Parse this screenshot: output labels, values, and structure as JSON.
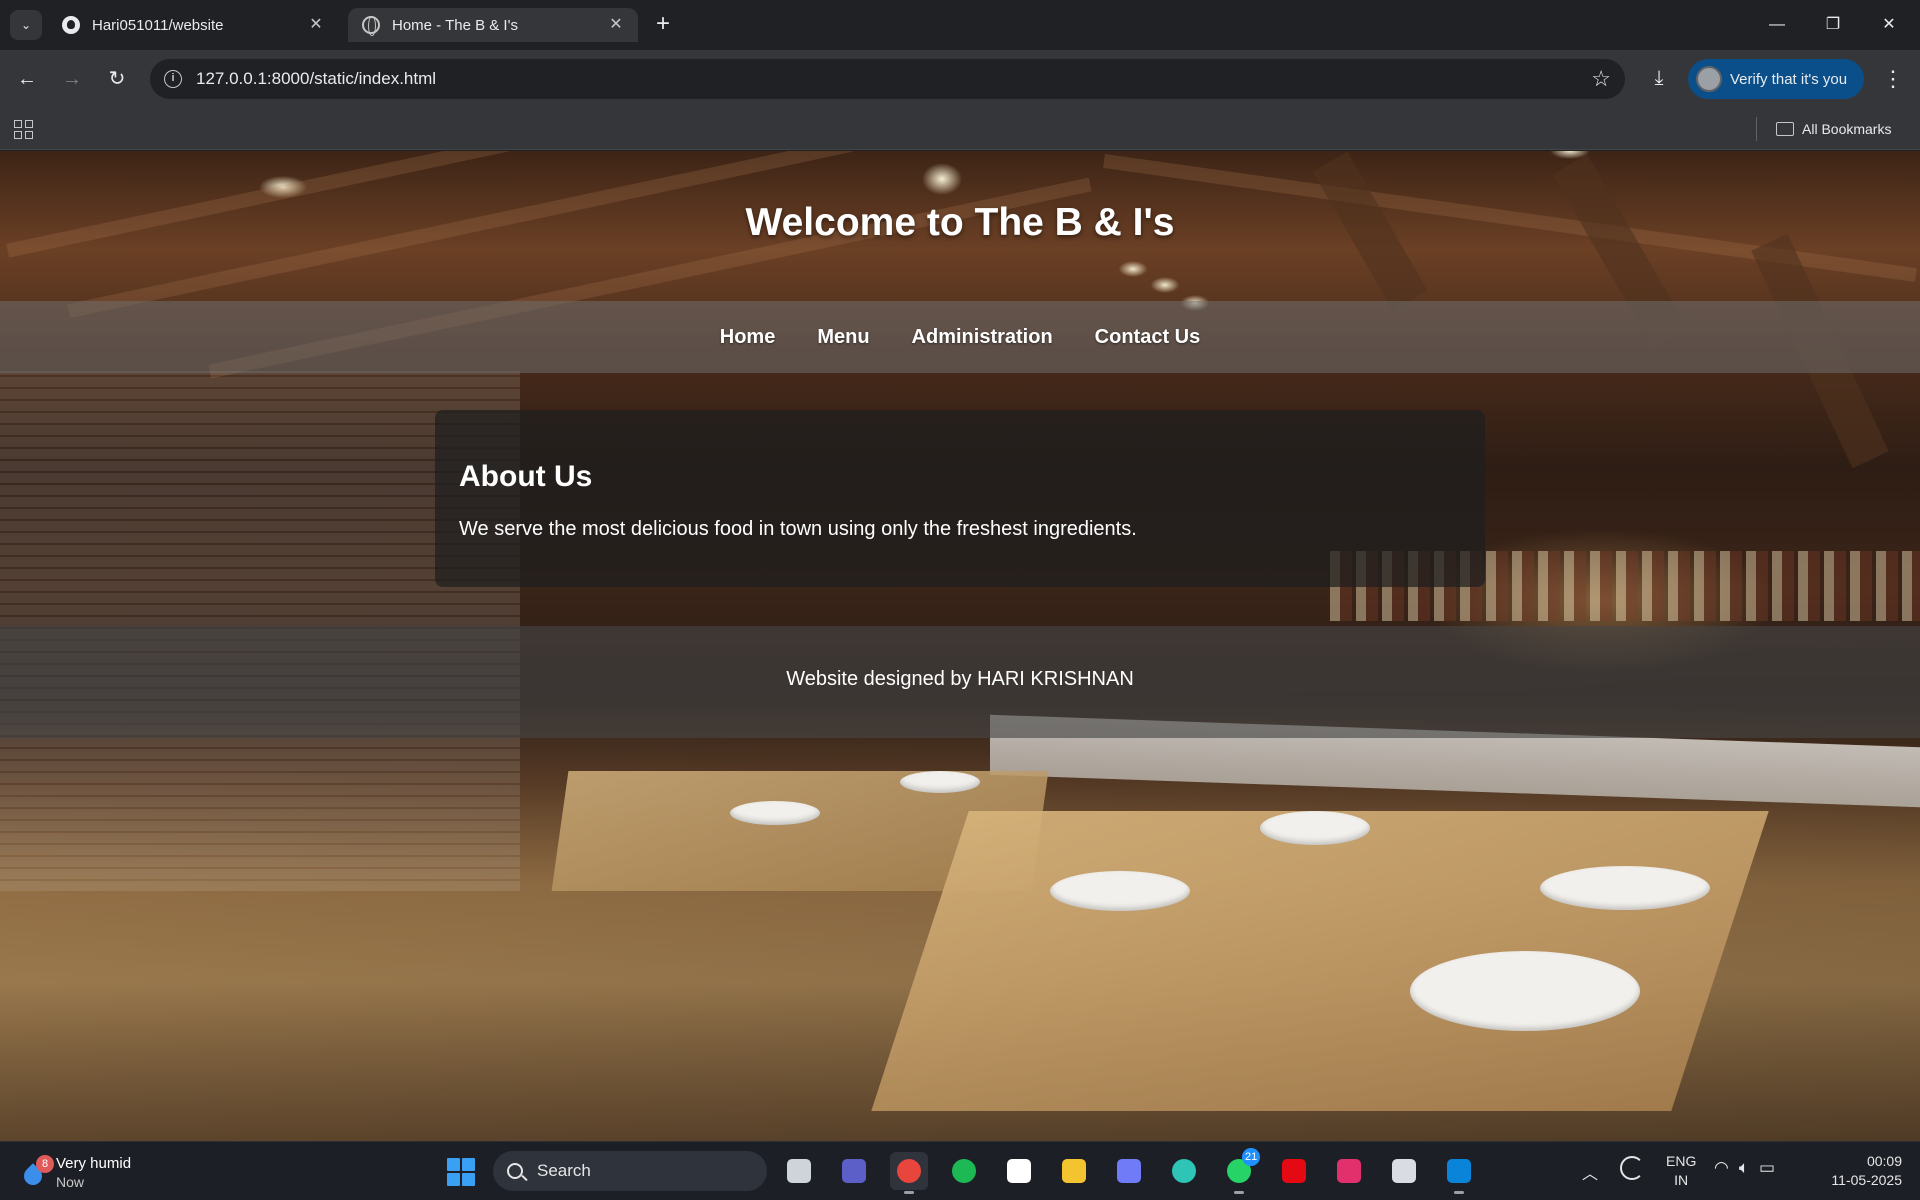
{
  "browser": {
    "tabs": [
      {
        "title": "Hari051011/website",
        "favicon": "github-icon",
        "active": false
      },
      {
        "title": "Home - The B & I's",
        "favicon": "globe-icon",
        "active": true
      }
    ],
    "address_bar": {
      "url": "127.0.0.1:8000/static/index.html"
    },
    "profile_button": {
      "label": "Verify that it's you"
    },
    "bookmarks": {
      "all_bookmarks_label": "All Bookmarks"
    }
  },
  "page": {
    "header": {
      "title": "Welcome to The B & I's"
    },
    "nav": {
      "items": [
        "Home",
        "Menu",
        "Administration",
        "Contact Us"
      ]
    },
    "about": {
      "title": "About Us",
      "text": "We serve the most delicious food in town using only the freshest ingredients."
    },
    "footer": {
      "text": "Website designed by HARI KRISHNAN"
    }
  },
  "taskbar": {
    "weather": {
      "condition": "Very humid",
      "time": "Now",
      "badge": "8"
    },
    "search_label": "Search",
    "apps": [
      {
        "name": "task-view",
        "color": "#cfd3da"
      },
      {
        "name": "teams",
        "color": "#5b5fc7"
      },
      {
        "name": "chrome",
        "color": "#e8453c"
      },
      {
        "name": "loop",
        "color": "#1db954"
      },
      {
        "name": "store",
        "color": "#ffffff"
      },
      {
        "name": "file-explorer",
        "color": "#f4c430"
      },
      {
        "name": "app",
        "color": "#6f7bf7"
      },
      {
        "name": "edge",
        "color": "#2ec4b6"
      },
      {
        "name": "whatsapp",
        "color": "#25d366",
        "badge": "21"
      },
      {
        "name": "netflix",
        "color": "#e50914"
      },
      {
        "name": "instagram",
        "color": "#e1306c"
      },
      {
        "name": "snipping-tool",
        "color": "#d9dde3"
      },
      {
        "name": "vs-code",
        "color": "#0a84d8"
      }
    ],
    "lang": {
      "line1": "ENG",
      "line2": "IN"
    },
    "clock": {
      "time": "00:09",
      "date": "11-05-2025"
    }
  }
}
